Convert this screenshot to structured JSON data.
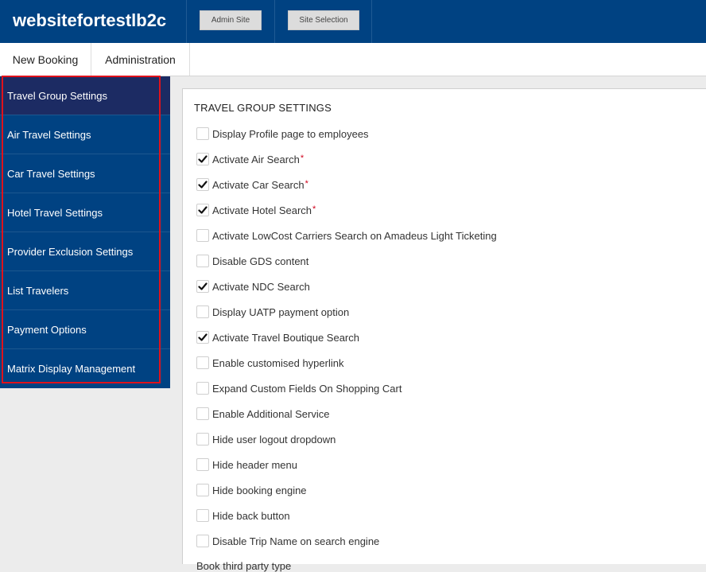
{
  "header": {
    "brand": "websitefortestlb2c",
    "admin_site_label": "Admin Site",
    "site_selection_label": "Site Selection"
  },
  "nav": {
    "new_booking": "New Booking",
    "administration": "Administration"
  },
  "sidebar": {
    "items": [
      {
        "label": "Travel Group Settings",
        "active": true
      },
      {
        "label": "Air Travel Settings"
      },
      {
        "label": "Car Travel Settings"
      },
      {
        "label": "Hotel Travel Settings"
      },
      {
        "label": "Provider Exclusion Settings"
      },
      {
        "label": "List Travelers"
      },
      {
        "label": "Payment Options"
      },
      {
        "label": "Matrix Display Management"
      }
    ]
  },
  "panel": {
    "title": "TRAVEL GROUP SETTINGS",
    "required_mark": "*",
    "options": [
      {
        "label": "Display Profile page to employees",
        "checked": false
      },
      {
        "label": "Activate Air Search",
        "checked": true,
        "required": true
      },
      {
        "label": "Activate Car Search",
        "checked": true,
        "required": true
      },
      {
        "label": "Activate Hotel Search",
        "checked": true,
        "required": true
      },
      {
        "label": "Activate LowCost Carriers Search on Amadeus Light Ticketing",
        "checked": false
      },
      {
        "label": "Disable GDS content",
        "checked": false
      },
      {
        "label": "Activate NDC Search",
        "checked": true
      },
      {
        "label": "Display UATP payment option",
        "checked": false
      },
      {
        "label": "Activate Travel Boutique Search",
        "checked": true
      },
      {
        "label": "Enable customised hyperlink",
        "checked": false
      },
      {
        "label": "Expand Custom Fields On Shopping Cart",
        "checked": false
      },
      {
        "label": "Enable Additional Service",
        "checked": false
      },
      {
        "label": "Hide user logout dropdown",
        "checked": false
      },
      {
        "label": "Hide header menu",
        "checked": false
      },
      {
        "label": "Hide booking engine",
        "checked": false
      },
      {
        "label": "Hide back button",
        "checked": false
      },
      {
        "label": "Disable Trip Name on search engine",
        "checked": false
      }
    ],
    "cut_off_label": "Book third party type"
  },
  "colors": {
    "brand_blue": "#004282",
    "active_sidebar": "#1c2b63",
    "highlight_red": "#e0121b"
  }
}
